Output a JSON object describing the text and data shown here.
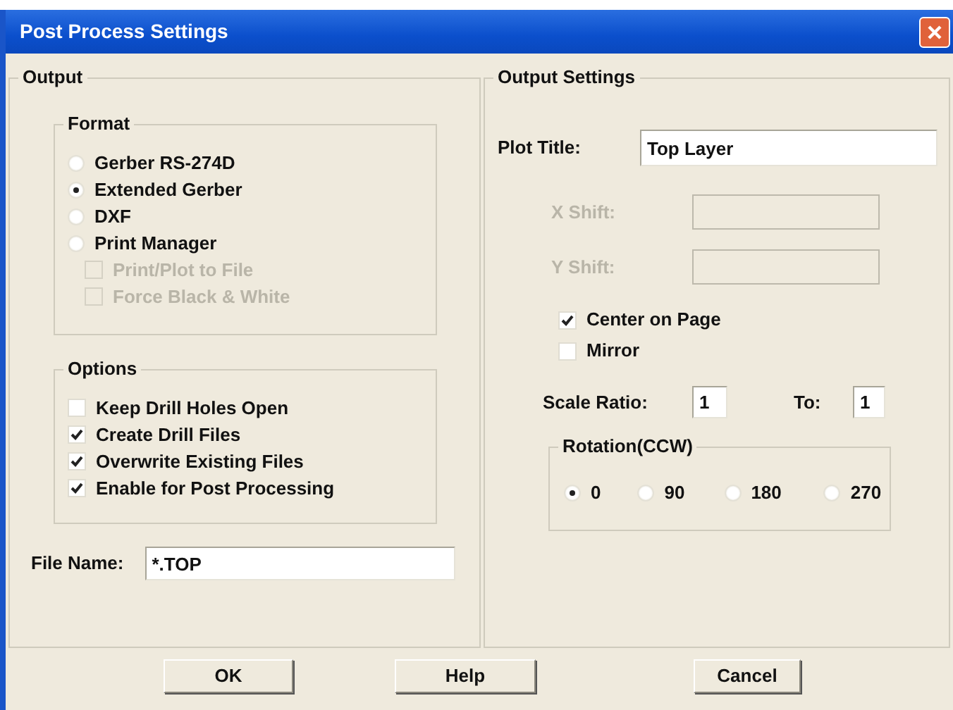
{
  "window": {
    "title": "Post Process Settings"
  },
  "output": {
    "title": "Output",
    "format": {
      "title": "Format",
      "choices": [
        {
          "label": "Gerber RS-274D",
          "selected": false
        },
        {
          "label": "Extended Gerber",
          "selected": true
        },
        {
          "label": "DXF",
          "selected": false
        },
        {
          "label": "Print Manager",
          "selected": false
        }
      ],
      "sub_options": [
        {
          "label": "Print/Plot to File",
          "checked": false,
          "disabled": true
        },
        {
          "label": "Force Black & White",
          "checked": false,
          "disabled": true
        }
      ]
    },
    "options": {
      "title": "Options",
      "items": [
        {
          "label": "Keep Drill Holes Open",
          "checked": false
        },
        {
          "label": "Create Drill Files",
          "checked": true
        },
        {
          "label": "Overwrite Existing Files",
          "checked": true
        },
        {
          "label": "Enable for Post Processing",
          "checked": true
        }
      ]
    },
    "file_name": {
      "label": "File Name:",
      "value": "*.TOP"
    }
  },
  "output_settings": {
    "title": "Output Settings",
    "plot_title": {
      "label": "Plot Title:",
      "value": "Top Layer"
    },
    "shifts": [
      {
        "label": "X Shift:",
        "disabled": true
      },
      {
        "label": "Y Shift:",
        "disabled": true
      }
    ],
    "checks": [
      {
        "label": "Center on Page",
        "checked": true
      },
      {
        "label": "Mirror",
        "checked": false
      }
    ],
    "scale_ratio": {
      "label": "Scale Ratio:",
      "value": "1"
    },
    "to": {
      "label": "To:",
      "value": "1"
    },
    "rotation": {
      "title": "Rotation(CCW)",
      "choices": [
        {
          "label": "0",
          "selected": true
        },
        {
          "label": "90",
          "selected": false
        },
        {
          "label": "180",
          "selected": false
        },
        {
          "label": "270",
          "selected": false
        }
      ]
    }
  },
  "buttons": [
    {
      "label": "OK"
    },
    {
      "label": "Help"
    },
    {
      "label": "Cancel"
    }
  ]
}
